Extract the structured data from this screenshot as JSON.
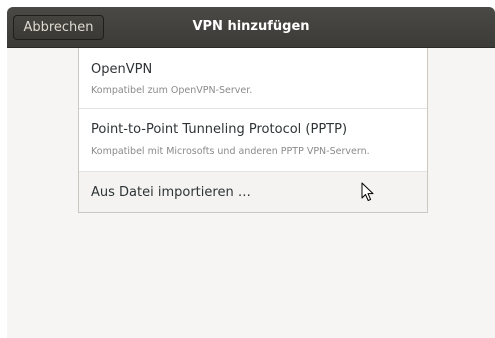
{
  "header": {
    "cancel_label": "Abbrechen",
    "title": "VPN hinzufügen"
  },
  "options": [
    {
      "title": "OpenVPN",
      "subtitle": "Kompatibel zum OpenVPN-Server."
    },
    {
      "title": "Point-to-Point Tunneling Protocol (PPTP)",
      "subtitle": "Kompatibel mit Microsofts und anderen PPTP VPN-Servern."
    },
    {
      "title": "Aus Datei importieren …"
    }
  ],
  "colors": {
    "headerbar": "#3c3b37",
    "title_text": "#ffffff",
    "row_title": "#2e3436",
    "row_subtitle": "#8a8a8a",
    "window_bg": "#f6f5f4"
  },
  "icons": {
    "pointer": "mouse-pointer-icon"
  }
}
